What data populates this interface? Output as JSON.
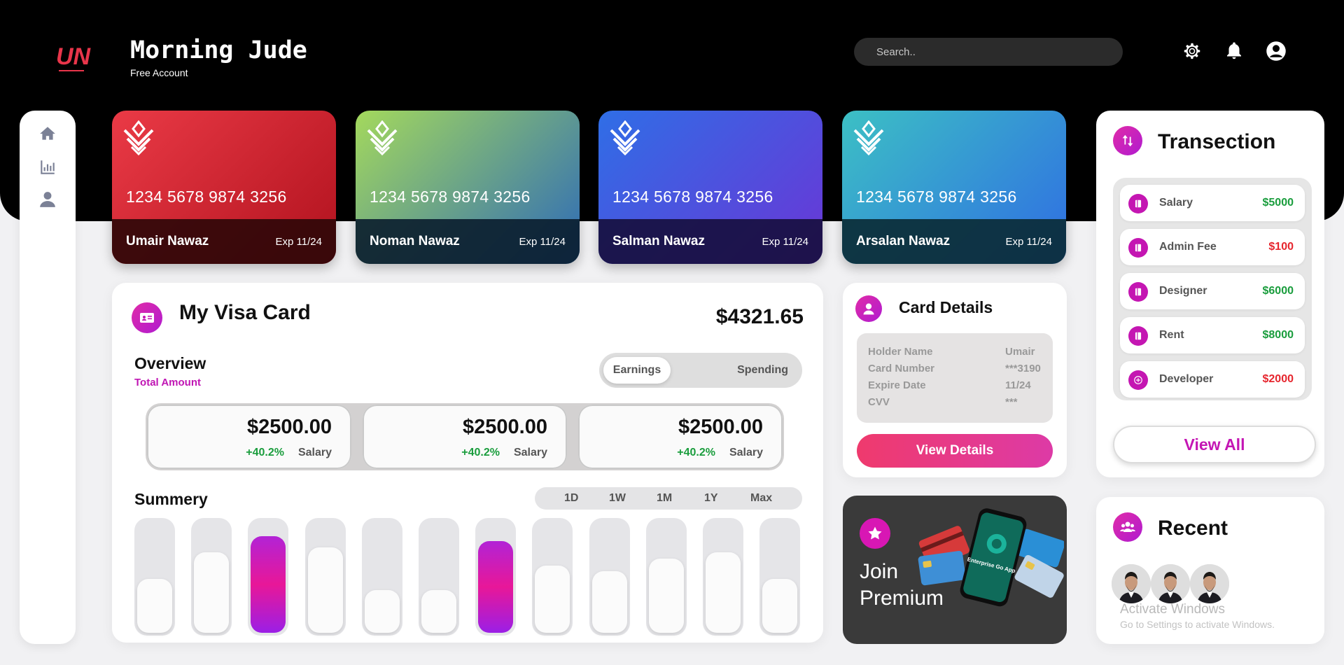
{
  "header": {
    "logo_text": "UN",
    "greeting": "Morning Jude",
    "account_type": "Free Account",
    "search_placeholder": "Search..",
    "icons": [
      "gear-icon",
      "bell-icon",
      "user-circle-icon"
    ]
  },
  "sidebar": {
    "items": [
      {
        "name": "home",
        "icon": "home-icon"
      },
      {
        "name": "analytics",
        "icon": "bar-chart-icon"
      },
      {
        "name": "profile",
        "icon": "user-icon"
      }
    ]
  },
  "cards": [
    {
      "number": "1234 5678 9874 3256",
      "holder": "Umair Nawaz",
      "expiry": "Exp 11/24",
      "gradient": [
        "#ea3a46",
        "#b1121e"
      ],
      "footer": "#2c0708"
    },
    {
      "number": "1234 5678 9874 3256",
      "holder": "Noman Nawaz",
      "expiry": "Exp 11/24",
      "gradient": [
        "#a4d95c",
        "#2d6ab8"
      ],
      "footer": "#0a1d2e"
    },
    {
      "number": "1234 5678 9874 3256",
      "holder": "Salman Nawaz",
      "expiry": "Exp 11/24",
      "gradient": [
        "#2f6ee6",
        "#6a36d6"
      ],
      "footer": "#160e3d"
    },
    {
      "number": "1234 5678 9874 3256",
      "holder": "Arsalan Nawaz",
      "expiry": "Exp 11/24",
      "gradient": [
        "#3cc0c4",
        "#2f6de3"
      ],
      "footer": "#0a2a34"
    }
  ],
  "visa": {
    "title": "My Visa Card",
    "amount": "$4321.65",
    "overview": "Overview",
    "total_label": "Total Amount",
    "toggle": {
      "earnings": "Earnings",
      "spending": "Spending",
      "selected": "Earnings"
    },
    "stats": [
      {
        "amount": "$2500.00",
        "change": "+40.2%",
        "label": "Salary"
      },
      {
        "amount": "$2500.00",
        "change": "+40.2%",
        "label": "Salary"
      },
      {
        "amount": "$2500.00",
        "change": "+40.2%",
        "label": "Salary"
      }
    ],
    "summary_title": "Summery",
    "periods": [
      "1D",
      "1W",
      "1M",
      "1Y",
      "Max"
    ],
    "bars": [
      {
        "level": 0.48,
        "highlight": false
      },
      {
        "level": 0.72,
        "highlight": false
      },
      {
        "level": 0.86,
        "highlight": true
      },
      {
        "level": 0.76,
        "highlight": false
      },
      {
        "level": 0.38,
        "highlight": false
      },
      {
        "level": 0.38,
        "highlight": false
      },
      {
        "level": 0.82,
        "highlight": true
      },
      {
        "level": 0.6,
        "highlight": false
      },
      {
        "level": 0.55,
        "highlight": false
      },
      {
        "level": 0.66,
        "highlight": false
      },
      {
        "level": 0.72,
        "highlight": false
      },
      {
        "level": 0.48,
        "highlight": false
      }
    ]
  },
  "card_details": {
    "title": "Card Details",
    "rows": [
      {
        "label": "Holder Name",
        "value": "Umair"
      },
      {
        "label": "Card Number",
        "value": "***3190"
      },
      {
        "label": "Expire Date",
        "value": "11/24"
      },
      {
        "label": "CVV",
        "value": "***"
      }
    ],
    "button": "View Details"
  },
  "premium": {
    "line1": "Join",
    "line2": "Premium",
    "phone_text": "Enterprise Go App"
  },
  "transactions": {
    "title": "Transection",
    "items": [
      {
        "name": "Salary",
        "amount": "$5000",
        "type": "pos"
      },
      {
        "name": "Admin Fee",
        "amount": "$100",
        "type": "neg"
      },
      {
        "name": "Designer",
        "amount": "$6000",
        "type": "pos"
      },
      {
        "name": "Rent",
        "amount": "$8000",
        "type": "pos"
      },
      {
        "name": "Developer",
        "amount": "$2000",
        "type": "neg"
      }
    ],
    "view_all": "View All"
  },
  "recent": {
    "title": "Recent",
    "avatar_count": 3
  },
  "watermark": {
    "title": "Activate Windows",
    "subtitle": "Go to Settings to activate Windows."
  },
  "colors": {
    "accent": "#c416b4",
    "positive": "#1a9d3d",
    "negative": "#e6262e"
  }
}
